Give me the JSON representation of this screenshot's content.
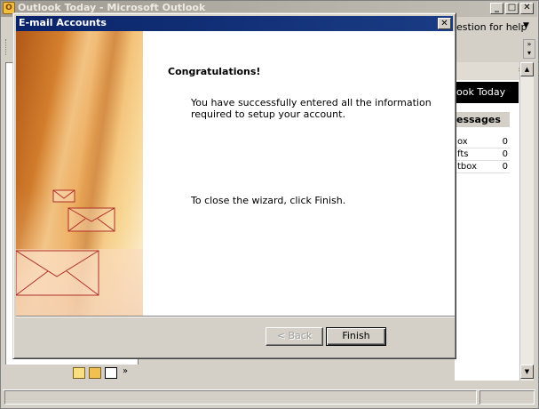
{
  "outlook": {
    "title": "Outlook Today - Microsoft Outlook",
    "help_prompt": "estion for help",
    "today_heading": "ook Today",
    "messages_heading": "essages",
    "messages": [
      {
        "name": "ox",
        "count": "0"
      },
      {
        "name": "fts",
        "count": "0"
      },
      {
        "name": "tbox",
        "count": "0"
      }
    ]
  },
  "dialog": {
    "title": "E-mail Accounts",
    "heading": "Congratulations!",
    "message": "You have successfully entered all the information required to setup your account.",
    "instruction": "To close the wizard, click Finish.",
    "back_label": "< Back",
    "finish_label": "Finish",
    "close_glyph": "✕"
  },
  "colors": {
    "title_active": "#0a246a",
    "face": "#d4d0c8",
    "art_dark": "#b05818",
    "art_light": "#fdf0d8"
  }
}
